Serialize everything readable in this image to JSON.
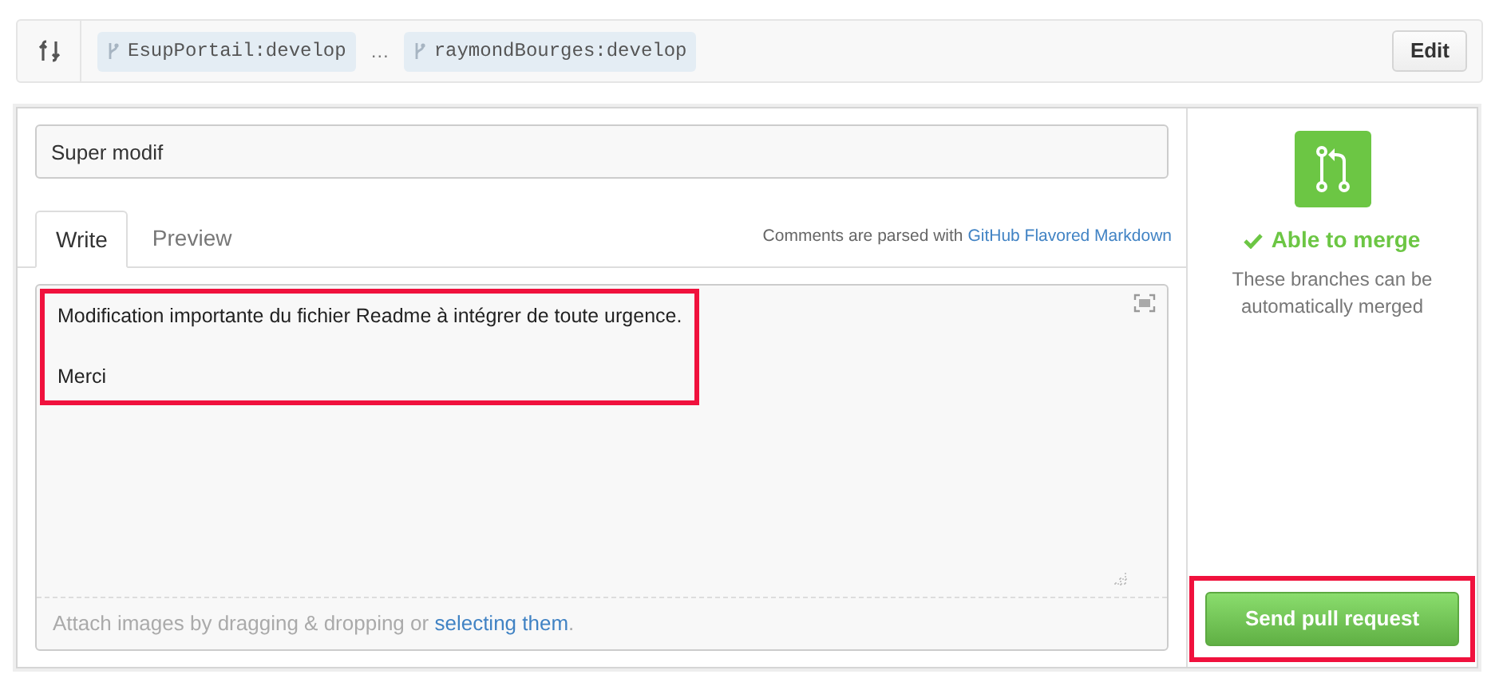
{
  "compare_bar": {
    "base": "EsupPortail:develop",
    "separator": "…",
    "head": "raymondBourges:develop",
    "edit_button": "Edit"
  },
  "title_field": {
    "value": "Super modif"
  },
  "tabs": [
    {
      "label": "Write",
      "selected": true
    },
    {
      "label": "Preview",
      "selected": false
    }
  ],
  "markdown_note": {
    "text": "Comments are parsed with",
    "link": "GitHub Flavored Markdown"
  },
  "comment": {
    "paragraphs": [
      "Modification importante du fichier Readme à intégrer de toute urgence.",
      "Merci"
    ],
    "highlighted": true
  },
  "attach_note": {
    "text": "Attach images by dragging & dropping or",
    "link": "selecting them",
    "suffix": "."
  },
  "merge_status": {
    "title": "Able to merge",
    "description": "These branches can be automatically merged"
  },
  "submit_button": {
    "label": "Send pull request",
    "highlighted": true
  }
}
